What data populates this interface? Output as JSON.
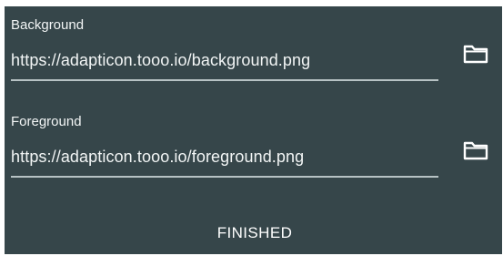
{
  "fields": {
    "background": {
      "label": "Background",
      "value": "https://adapticon.tooo.io/background.png",
      "icon": "folder-icon"
    },
    "foreground": {
      "label": "Foreground",
      "value": "https://adapticon.tooo.io/foreground.png",
      "icon": "folder-icon"
    }
  },
  "actions": {
    "finished_label": "FINISHED"
  },
  "colors": {
    "panel_background": "#36464a",
    "text": "#ffffff",
    "underline": "#b7c2c4"
  }
}
